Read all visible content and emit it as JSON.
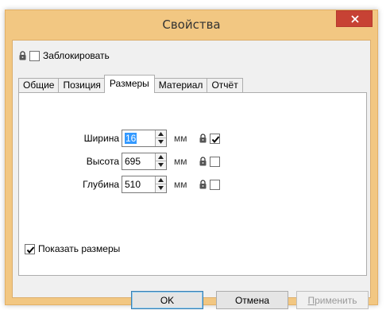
{
  "window": {
    "title": "Свойства"
  },
  "lock_all": {
    "label": "Заблокировать",
    "checked": false
  },
  "tabs": [
    {
      "label": "Общие",
      "active": false
    },
    {
      "label": "Позиция",
      "active": false
    },
    {
      "label": "Размеры",
      "active": true
    },
    {
      "label": "Материал",
      "active": false
    },
    {
      "label": "Отчёт",
      "active": false
    }
  ],
  "fields": [
    {
      "label": "Ширина",
      "value": "16",
      "unit": "мм",
      "locked": true
    },
    {
      "label": "Высота",
      "value": "695",
      "unit": "мм",
      "locked": false
    },
    {
      "label": "Глубина",
      "value": "510",
      "unit": "мм",
      "locked": false
    }
  ],
  "show_dims": {
    "label": "Показать размеры",
    "checked": true
  },
  "buttons": {
    "ok": "OK",
    "cancel": "Отмена",
    "apply_first": "П",
    "apply_rest": "рименить"
  },
  "colors": {
    "frame": "#f2c782",
    "close": "#c74234",
    "selection": "#3399ff"
  }
}
